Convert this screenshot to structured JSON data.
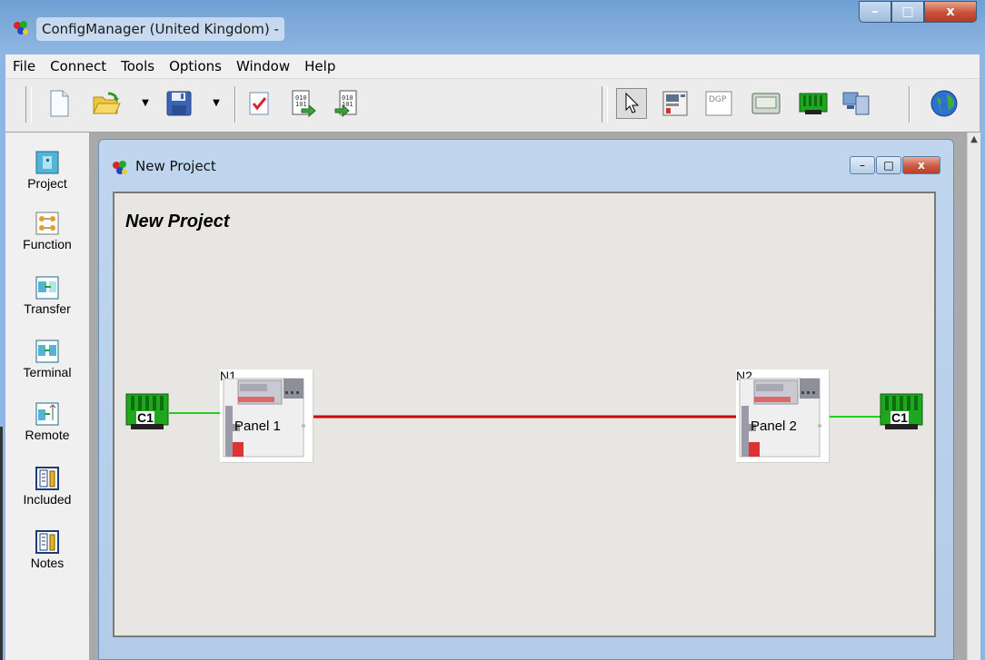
{
  "window": {
    "title": "ConfigManager (United Kingdom) -",
    "minimize_glyph": "–",
    "maximize_glyph": "□",
    "close_glyph": "x"
  },
  "menu": [
    "File",
    "Connect",
    "Tools",
    "Options",
    "Window",
    "Help"
  ],
  "toolbar": {
    "left_buttons": [
      "new-document-icon",
      "open-folder-icon",
      "save-disk-icon",
      "check-document-icon",
      "upload-config-icon",
      "download-config-icon"
    ],
    "right_buttons": [
      "pointer-arrow-icon",
      "panel-layout-icon",
      "dgp-label-icon",
      "display-unit-icon",
      "loop-card-icon",
      "network-computer-icon",
      "globe-icon"
    ],
    "dgp_label": "DGP"
  },
  "sidebar": {
    "items": [
      {
        "label": "Project",
        "icon": "project-icon"
      },
      {
        "label": "Function",
        "icon": "function-icon"
      },
      {
        "label": "Transfer",
        "icon": "transfer-icon"
      },
      {
        "label": "Terminal",
        "icon": "terminal-icon"
      },
      {
        "label": "Remote",
        "icon": "remote-icon"
      },
      {
        "label": "Included",
        "icon": "included-icon"
      },
      {
        "label": "Notes",
        "icon": "notes-icon"
      }
    ]
  },
  "child_window": {
    "title": "New Project",
    "minimize_glyph": "–",
    "maximize_glyph": "□",
    "close_glyph": "x"
  },
  "diagram": {
    "project_title": "New Project",
    "panels": [
      {
        "id": "N1",
        "label": "Panel 1"
      },
      {
        "id": "N2",
        "label": "Panel 2"
      }
    ],
    "loops": [
      {
        "label": "C1"
      },
      {
        "label": "C1"
      }
    ],
    "colors": {
      "network_link": "#cc0000",
      "loop_link": "#22cc22",
      "loop_card": "#1fa81f"
    }
  }
}
